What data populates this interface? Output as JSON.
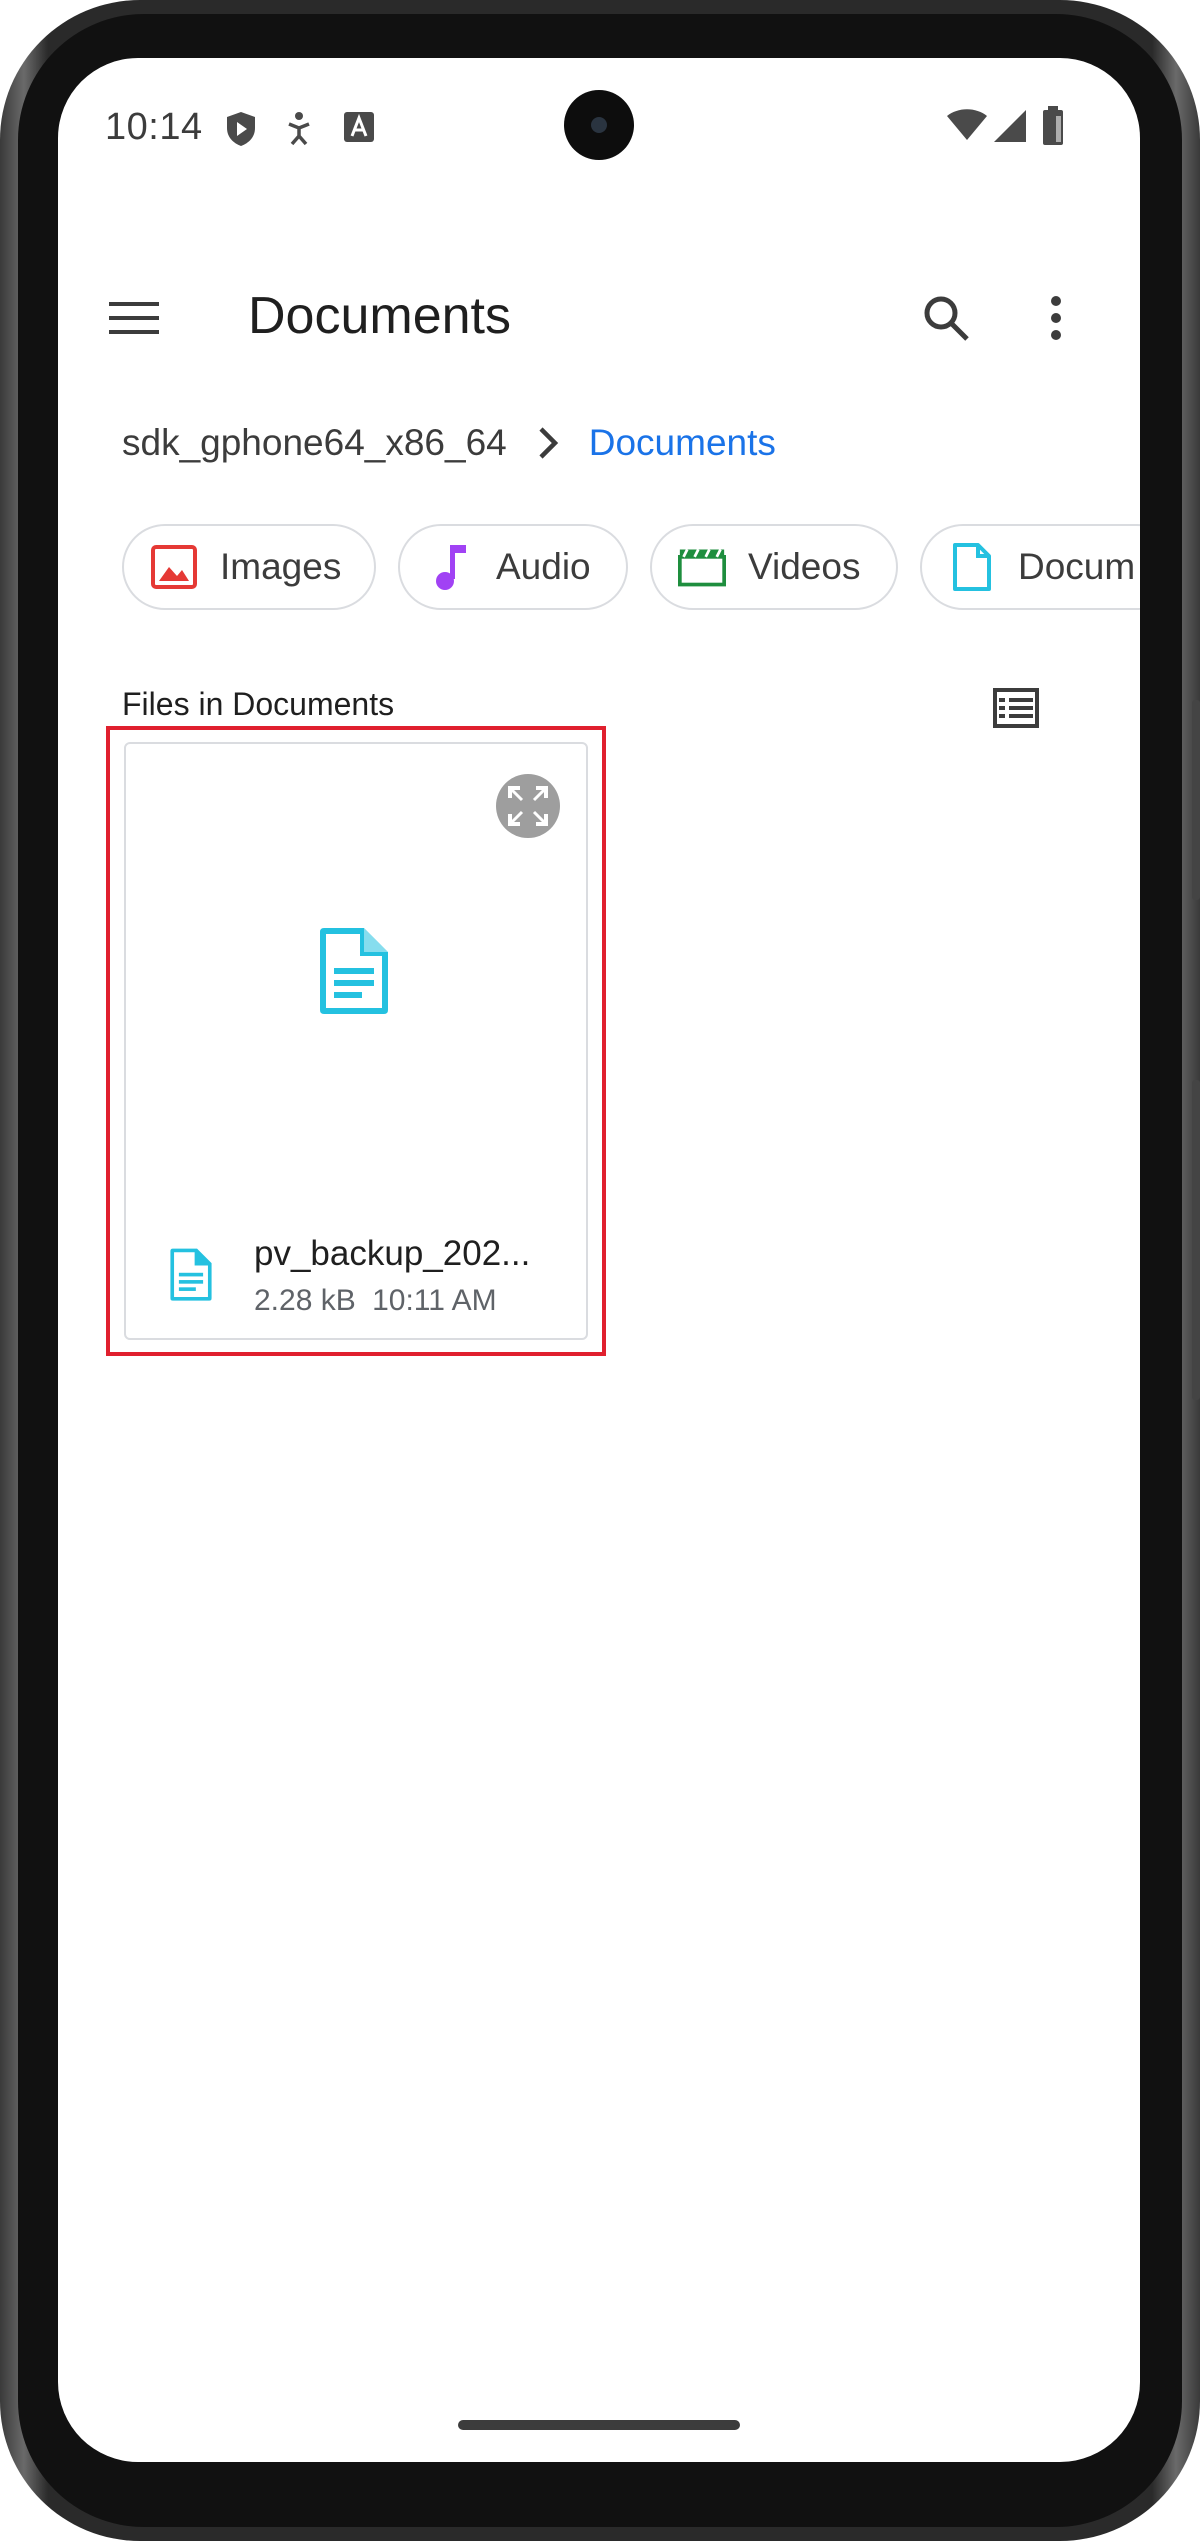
{
  "status_bar": {
    "time": "10:14",
    "icons_left": [
      "shield-icon",
      "accessibility-icon",
      "font-icon"
    ],
    "icons_right": [
      "wifi-icon",
      "cellular-signal-icon",
      "battery-icon"
    ]
  },
  "app_bar": {
    "title": "Documents",
    "menu_icon": "hamburger-menu-icon",
    "search_icon": "search-icon",
    "more_icon": "more-vert-icon"
  },
  "breadcrumb": {
    "root": "sdk_gphone64_x86_64",
    "current": "Documents"
  },
  "chips": [
    {
      "label": "Images",
      "icon": "image-icon",
      "color": "#e53935"
    },
    {
      "label": "Audio",
      "icon": "music-note-icon",
      "color": "#a142f4"
    },
    {
      "label": "Videos",
      "icon": "movie-icon",
      "color": "#1e8e3e"
    },
    {
      "label": "Docum",
      "icon": "document-icon",
      "color": "#24c1e0"
    }
  ],
  "section": {
    "title": "Files in Documents",
    "view_toggle_icon": "list-view-icon"
  },
  "files": [
    {
      "name": "pv_backup_202...",
      "size": "2.28 kB",
      "time": "10:11 AM",
      "icon": "document-icon",
      "icon_color": "#24c1e0"
    }
  ],
  "colors": {
    "accent": "#1a73e8",
    "highlight": "#e0202e"
  }
}
